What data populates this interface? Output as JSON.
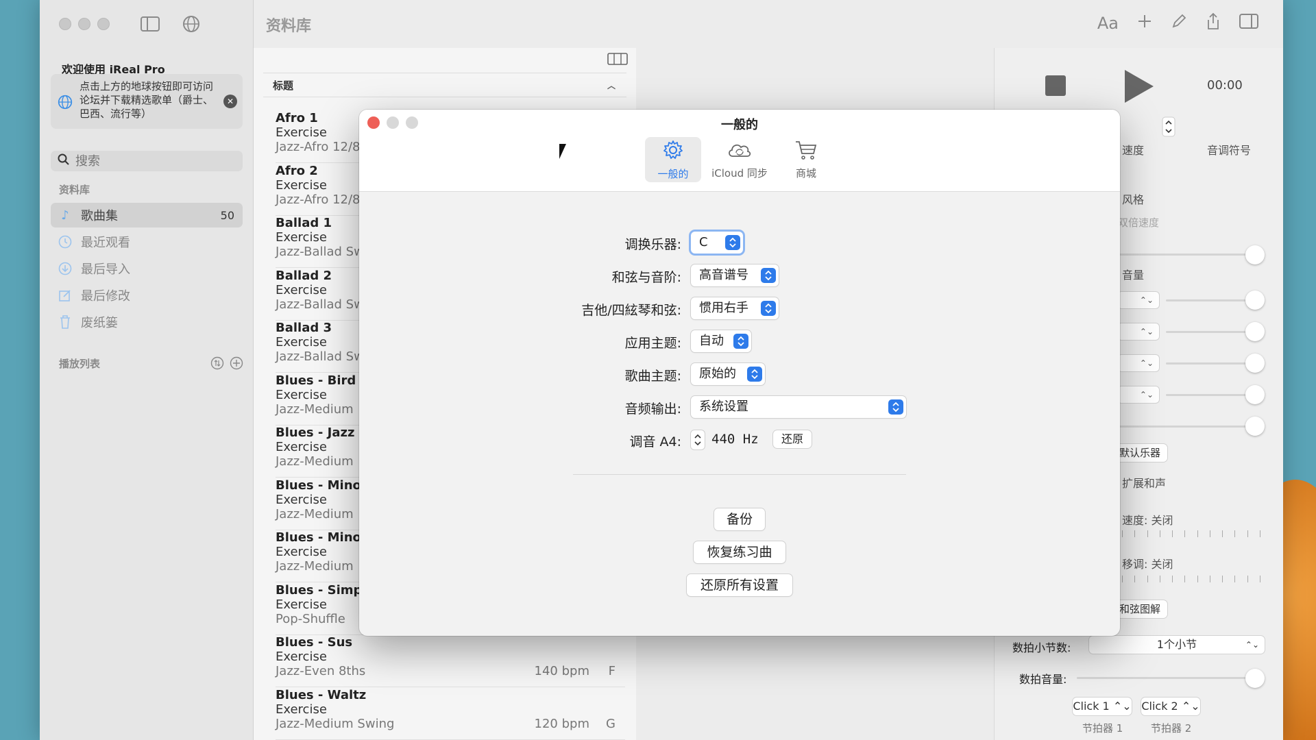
{
  "sidebar": {
    "welcome_title": "欢迎使用 iReal Pro",
    "welcome_text": "点击上方的地球按钮即可访问论坛并下载精选歌单（爵士、巴西、流行等）",
    "search_placeholder": "搜索",
    "library_section": "资料库",
    "items": [
      {
        "label": "歌曲集",
        "count": "50",
        "icon": "music-note-icon"
      },
      {
        "label": "最近观看",
        "icon": "clock-icon"
      },
      {
        "label": "最后导入",
        "icon": "download-icon"
      },
      {
        "label": "最后修改",
        "icon": "edit-icon"
      },
      {
        "label": "废纸篓",
        "icon": "trash-icon"
      }
    ],
    "playlist_section": "播放列表"
  },
  "main": {
    "title": "资料库",
    "column_header": "标题"
  },
  "songs": [
    {
      "title": "Afro 1",
      "sub": "Exercise",
      "genre": "Jazz-Afro 12/8",
      "bpm": "",
      "key": ""
    },
    {
      "title": "Afro 2",
      "sub": "Exercise",
      "genre": "Jazz-Afro 12/8",
      "bpm": "",
      "key": ""
    },
    {
      "title": "Ballad 1",
      "sub": "Exercise",
      "genre": "Jazz-Ballad Sw",
      "bpm": "",
      "key": ""
    },
    {
      "title": "Ballad 2",
      "sub": "Exercise",
      "genre": "Jazz-Ballad Sw",
      "bpm": "",
      "key": ""
    },
    {
      "title": "Ballad 3",
      "sub": "Exercise",
      "genre": "Jazz-Ballad Sw",
      "bpm": "",
      "key": ""
    },
    {
      "title": "Blues - Bird",
      "sub": "Exercise",
      "genre": "Jazz-Medium",
      "bpm": "",
      "key": ""
    },
    {
      "title": "Blues - Jazz",
      "sub": "Exercise",
      "genre": "Jazz-Medium",
      "bpm": "",
      "key": ""
    },
    {
      "title": "Blues - Minor",
      "sub": "Exercise",
      "genre": "Jazz-Medium",
      "bpm": "",
      "key": ""
    },
    {
      "title": "Blues - Minor",
      "sub": "Exercise",
      "genre": "Jazz-Medium",
      "bpm": "",
      "key": ""
    },
    {
      "title": "Blues - Simpl",
      "sub": "Exercise",
      "genre": "Pop-Shuffle",
      "bpm": "",
      "key": ""
    },
    {
      "title": "Blues - Sus",
      "sub": "Exercise",
      "genre": "Jazz-Even 8ths",
      "bpm": "140 bpm",
      "key": "F"
    },
    {
      "title": "Blues - Waltz",
      "sub": "Exercise",
      "genre": "Jazz-Medium Swing",
      "bpm": "120 bpm",
      "key": "G"
    }
  ],
  "toolbar": {
    "font_label": "Aa"
  },
  "player": {
    "time": "00:00",
    "tempo_label": "速度",
    "key_label": "音调符号",
    "style_label": "风格",
    "double_tempo": "双倍速度",
    "volume_label": "音量",
    "default_instrument": "默认乐器",
    "extended_harmony": "扩展和声",
    "tempo_status": "速度: 关闭",
    "transpose_status": "移调: 关闭",
    "chord_diagram": "和弦图解",
    "count_in_label": "数拍小节数:",
    "count_in_value": "1个小节",
    "count_volume_label": "数拍音量:",
    "click1": "Click 1",
    "click2": "Click 2",
    "metronome1": "节拍器 1",
    "metronome2": "节拍器 2"
  },
  "dialog": {
    "title": "一般的",
    "tabs": [
      {
        "label": "一般的",
        "icon": "gear-icon"
      },
      {
        "label": "iCloud 同步",
        "icon": "icloud-sync-icon"
      },
      {
        "label": "商城",
        "icon": "cart-icon"
      }
    ],
    "rows": [
      {
        "label": "调换乐器:",
        "value": "C"
      },
      {
        "label": "和弦与音阶:",
        "value": "高音谱号"
      },
      {
        "label": "吉他/四絃琴和弦:",
        "value": "惯用右手"
      },
      {
        "label": "应用主题:",
        "value": "自动"
      },
      {
        "label": "歌曲主题:",
        "value": "原始的"
      },
      {
        "label": "音频输出:",
        "value": "系统设置"
      }
    ],
    "tuning_label": "调音 A4:",
    "tuning_value": "440 Hz",
    "reset_label": "还原",
    "backup": "备份",
    "restore_exercises": "恢复练习曲",
    "reset_all": "还原所有设置"
  },
  "colors": {
    "accent": "#2e7bea",
    "close_red": "#ee5f57"
  }
}
